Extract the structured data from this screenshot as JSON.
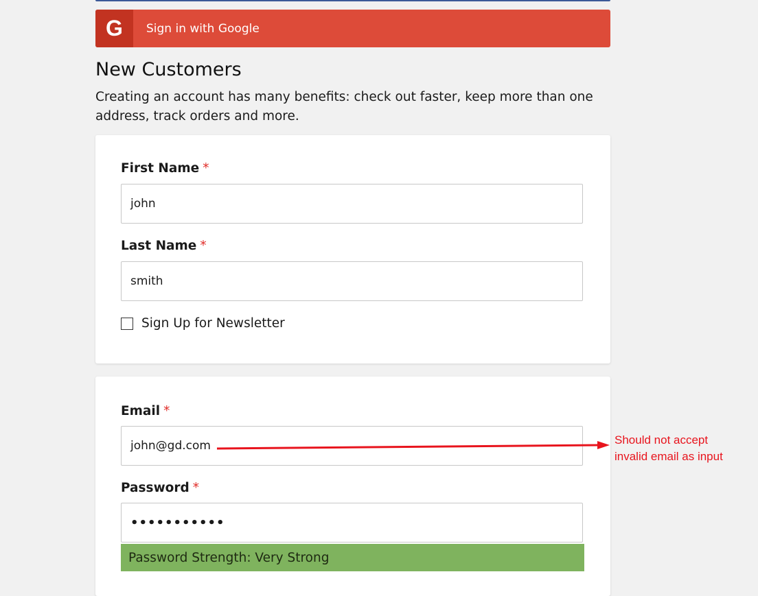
{
  "google_signin": {
    "icon_letter": "G",
    "label": "Sign in with Google",
    "color": "#dd4b39"
  },
  "new_customers": {
    "title": "New Customers",
    "description": "Creating an account has many benefits: check out faster, keep more than one address, track orders and more."
  },
  "personal_info": {
    "first_name": {
      "label": "First Name",
      "required_mark": "*",
      "value": "john"
    },
    "last_name": {
      "label": "Last Name",
      "required_mark": "*",
      "value": "smith"
    },
    "newsletter": {
      "label": "Sign Up for Newsletter",
      "checked": false
    }
  },
  "signin_info": {
    "email": {
      "label": "Email",
      "required_mark": "*",
      "value": "john@gd.com"
    },
    "password": {
      "label": "Password",
      "required_mark": "*",
      "masked_value": "•••••••••••"
    },
    "strength": {
      "text": "Password Strength: Very Strong",
      "color": "#7fb35e"
    }
  },
  "annotation": {
    "text": "Should not accept\ninvalid email as input",
    "color": "#e8141d"
  }
}
